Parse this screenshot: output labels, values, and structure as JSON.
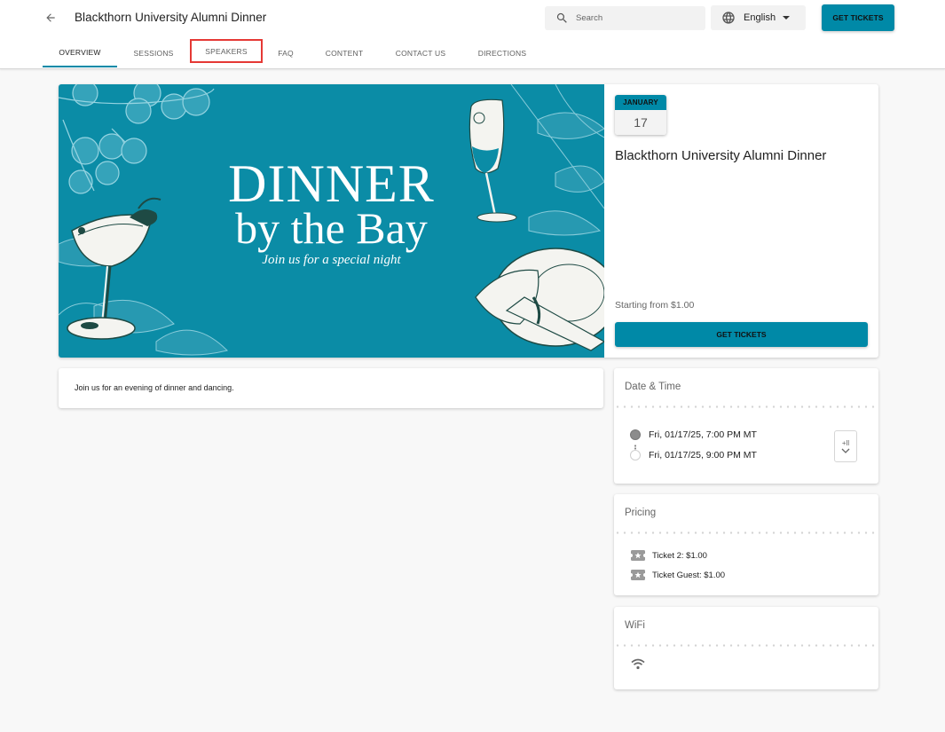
{
  "header": {
    "back_icon": "arrow-left-icon",
    "title": "Blackthorn University Alumni Dinner",
    "search": {
      "placeholder": "Search",
      "value": "",
      "icon": "search-icon"
    },
    "language": {
      "selected": "English",
      "icon": "globe-icon"
    },
    "get_tickets_label": "GET TICKETS"
  },
  "tabs": [
    {
      "label": "OVERVIEW",
      "active": true
    },
    {
      "label": "SESSIONS",
      "active": false
    },
    {
      "label": "SPEAKERS",
      "active": false,
      "highlighted": true
    },
    {
      "label": "FAQ",
      "active": false
    },
    {
      "label": "CONTENT",
      "active": false
    },
    {
      "label": "CONTACT US",
      "active": false
    },
    {
      "label": "DIRECTIONS",
      "active": false
    }
  ],
  "banner": {
    "line1": "DINNER",
    "line2": "by the Bay",
    "subtitle": "Join us for a special night",
    "background_color": "#0b8ca6"
  },
  "event": {
    "date_month": "JANUARY",
    "date_day": "17",
    "title": "Blackthorn University Alumni Dinner",
    "starting_from": "Starting from $1.00",
    "get_tickets_label": "GET TICKETS",
    "description": "Join us for an evening of dinner and dancing."
  },
  "date_time": {
    "title": "Date & Time",
    "start": "Fri, 01/17/25, 7:00 PM MT",
    "end": "Fri, 01/17/25, 9:00 PM MT",
    "calendar_button_label": "+ll",
    "calendar_icon": "add-to-calendar-icon"
  },
  "pricing": {
    "title": "Pricing",
    "items": [
      {
        "label": "Ticket 2: $1.00",
        "icon": "ticket-icon"
      },
      {
        "label": "Ticket Guest: $1.00",
        "icon": "ticket-icon"
      }
    ]
  },
  "wifi": {
    "title": "WiFi",
    "icon": "wifi-icon"
  },
  "colors": {
    "accent": "#0089a7",
    "highlight_outline": "#e53935",
    "page_background": "#f8f8f8"
  }
}
